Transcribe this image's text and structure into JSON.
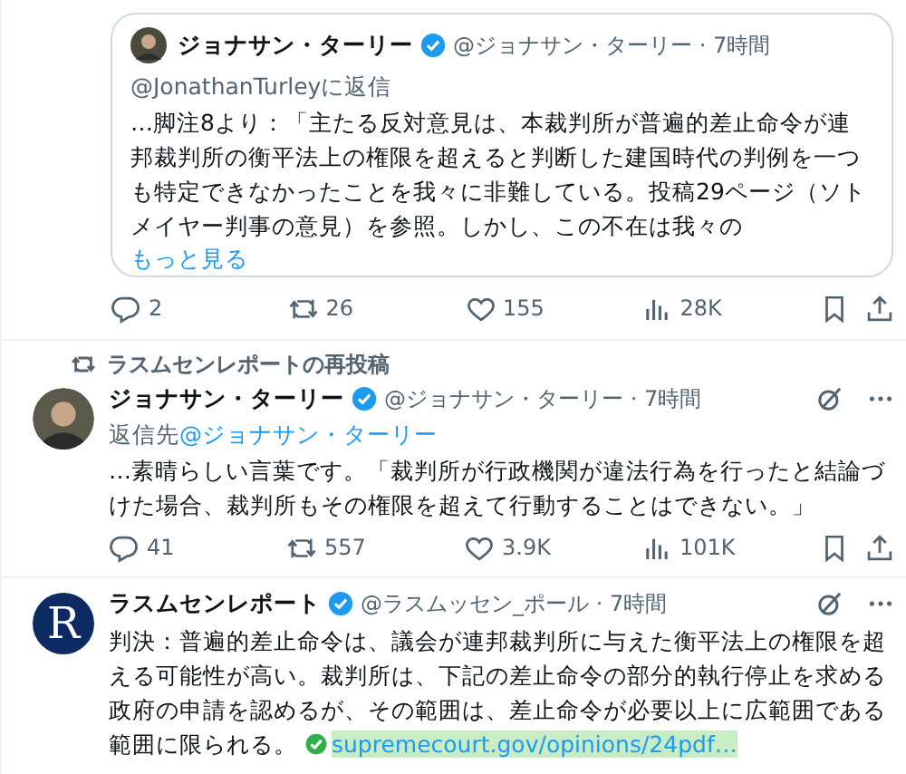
{
  "quoted_post": {
    "author_name": "ジョナサン・ターリー",
    "verified": true,
    "meta": "@ジョナサン・ターリー · 7時間",
    "reply_to": "@JonathanTurleyに返信",
    "body": "…脚注8より：「主たる反対意見は、本裁判所が普遍的差止命令が連邦裁判所の衡平法上の権限を超えると判断した建国時代の判例を一つも特定できなかったことを我々に非難している。投稿29ページ（ソトメイヤー判事の意見）を参照。しかし、この不在は我々の",
    "show_more": "もっと見る"
  },
  "quote_actions": [
    {
      "kind": "reply",
      "count": "2"
    },
    {
      "kind": "repost",
      "count": "26"
    },
    {
      "kind": "like",
      "count": "155"
    },
    {
      "kind": "views",
      "count": "28K"
    },
    {
      "kind": "bookmark"
    },
    {
      "kind": "share"
    }
  ],
  "posts": [
    {
      "repost_label": "ラスムセンレポートの再投稿",
      "author_name": "ジョナサン・ターリー",
      "verified": true,
      "meta": "@ジョナサン・ターリー · 7時間",
      "reply_label": "返信先",
      "reply_handle": "@ジョナサン・ターリー",
      "body": "…素晴らしい言葉です。「裁判所が行政機関が違法行為を行ったと結論づけた場合、裁判所もその権限を超えて行動することはできない。」",
      "actions": [
        {
          "kind": "reply",
          "count": "41"
        },
        {
          "kind": "repost",
          "count": "557"
        },
        {
          "kind": "like",
          "count": "3.9K"
        },
        {
          "kind": "views",
          "count": "101K"
        },
        {
          "kind": "bookmark"
        },
        {
          "kind": "share"
        }
      ]
    },
    {
      "avatar_letter": "R",
      "author_name": "ラスムセンレポート",
      "verified": true,
      "meta": "@ラスムッセン_ポール · 7時間",
      "body": "判決：普遍的差止命令は、議会が連邦裁判所に与えた衡平法上の権限を超える可能性が高い。裁判所は、下記の差止命令の部分的執行停止を求める政府の申請を認めるが、その範囲は、差止命令が必要以上に広範囲である範囲に限られる。",
      "link": {
        "text": "supremecourt.gov/opinions/24pdf…",
        "highlighted": true
      }
    }
  ]
}
